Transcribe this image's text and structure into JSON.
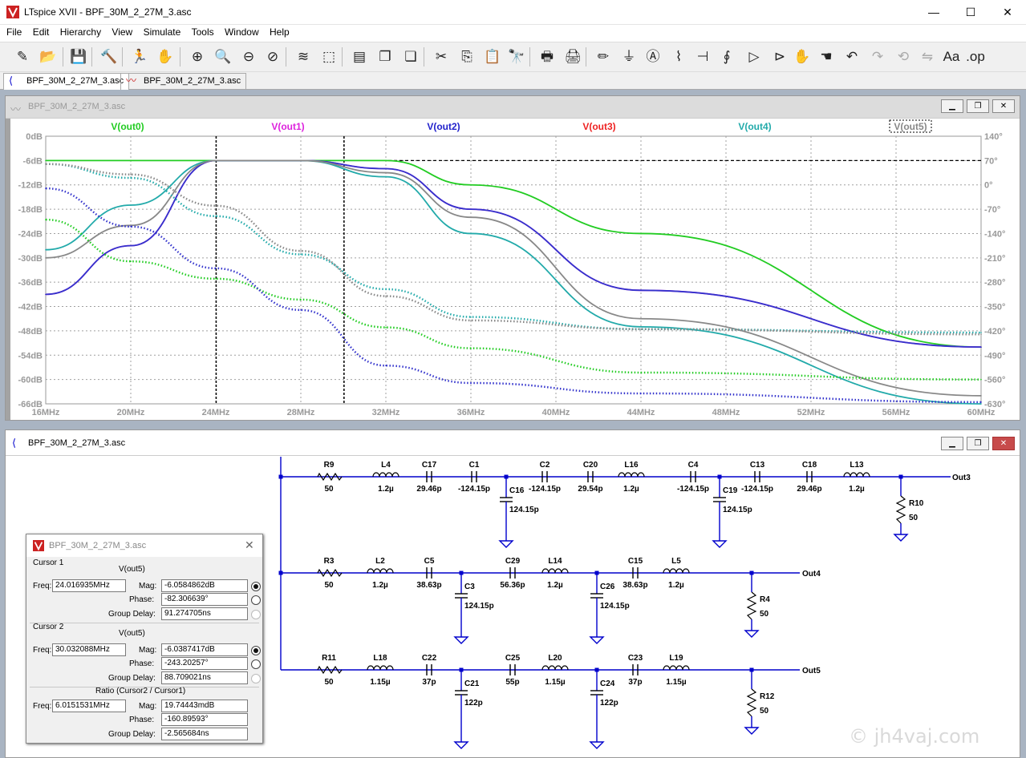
{
  "app": {
    "title": "LTspice XVII - BPF_30M_2_27M_3.asc",
    "menu": [
      "File",
      "Edit",
      "Hierarchy",
      "View",
      "Simulate",
      "Tools",
      "Window",
      "Help"
    ],
    "tabs": [
      {
        "label": "BPF_30M_2_27M_3.asc",
        "icon": "schematic-icon",
        "active": true
      },
      {
        "label": "BPF_30M_2_27M_3.asc",
        "icon": "waveform-icon",
        "active": false
      }
    ],
    "window_controls": {
      "minimize": "—",
      "maximize": "☐",
      "close": "✕"
    }
  },
  "toolbar": [
    {
      "icon": "new-schematic-icon",
      "glyph": "✎"
    },
    {
      "icon": "open-folder-icon",
      "glyph": "📂"
    },
    {
      "icon": "save-icon",
      "glyph": "💾"
    },
    {
      "icon": "control-panel-icon",
      "glyph": "🔨"
    },
    {
      "icon": "run-icon",
      "glyph": "🏃"
    },
    {
      "icon": "halt-icon",
      "glyph": "✋"
    },
    {
      "icon": "zoom-in-icon",
      "glyph": "⊕"
    },
    {
      "icon": "zoom-pan-icon",
      "glyph": "🔍"
    },
    {
      "icon": "zoom-out-icon",
      "glyph": "⊖"
    },
    {
      "icon": "zoom-cancel-icon",
      "glyph": "⊘"
    },
    {
      "icon": "autorange-icon",
      "glyph": "≋"
    },
    {
      "icon": "fit-icon",
      "glyph": "⬚"
    },
    {
      "icon": "tile-horizontal-icon",
      "glyph": "▤"
    },
    {
      "icon": "cascade-icon",
      "glyph": "❐"
    },
    {
      "icon": "tile-vertical-icon",
      "glyph": "❏"
    },
    {
      "icon": "cut-icon",
      "glyph": "✂"
    },
    {
      "icon": "copy-icon",
      "glyph": "⎘"
    },
    {
      "icon": "paste-icon",
      "glyph": "📋"
    },
    {
      "icon": "find-icon",
      "glyph": "🔭"
    },
    {
      "icon": "print-icon",
      "glyph": "🖶"
    },
    {
      "icon": "print-setup-icon",
      "glyph": "🖨"
    },
    {
      "icon": "draw-wire-icon",
      "glyph": "✏"
    },
    {
      "icon": "ground-icon",
      "glyph": "⏚"
    },
    {
      "icon": "label-net-icon",
      "glyph": "Ⓐ"
    },
    {
      "icon": "resistor-icon",
      "glyph": "⌇"
    },
    {
      "icon": "capacitor-icon",
      "glyph": "⊣"
    },
    {
      "icon": "inductor-icon",
      "glyph": "∮"
    },
    {
      "icon": "diode-icon",
      "glyph": "▷"
    },
    {
      "icon": "component-icon",
      "glyph": "⊳"
    },
    {
      "icon": "move-icon",
      "glyph": "✋"
    },
    {
      "icon": "drag-icon",
      "glyph": "☚"
    },
    {
      "icon": "undo-icon",
      "glyph": "↶"
    },
    {
      "icon": "redo-icon",
      "glyph": "↷"
    },
    {
      "icon": "rotate-icon",
      "glyph": "⟲"
    },
    {
      "icon": "mirror-icon",
      "glyph": "⇋"
    },
    {
      "icon": "text-icon",
      "glyph": "Aa"
    },
    {
      "icon": "spice-directive-icon",
      "glyph": ".op"
    }
  ],
  "plot_window": {
    "title": "BPF_30M_2_27M_3.asc",
    "y_left_ticks": [
      "0dB",
      "-6dB",
      "-12dB",
      "-18dB",
      "-24dB",
      "-30dB",
      "-36dB",
      "-42dB",
      "-48dB",
      "-54dB",
      "-60dB",
      "-66dB"
    ],
    "y_right_ticks": [
      "140°",
      "70°",
      "0°",
      "-70°",
      "-140°",
      "-210°",
      "-280°",
      "-350°",
      "-420°",
      "-490°",
      "-560°",
      "-630°"
    ],
    "x_ticks": [
      "16MHz",
      "20MHz",
      "24MHz",
      "28MHz",
      "32MHz",
      "36MHz",
      "40MHz",
      "44MHz",
      "48MHz",
      "52MHz",
      "56MHz",
      "60MHz"
    ],
    "trace_labels": [
      {
        "label": "V(out0)",
        "color": "#22cc22"
      },
      {
        "label": "V(out1)",
        "color": "#dd22dd"
      },
      {
        "label": "V(out2)",
        "color": "#2222cc"
      },
      {
        "label": "V(out3)",
        "color": "#ee2222"
      },
      {
        "label": "V(out4)",
        "color": "#22aaaa"
      },
      {
        "label": "V(out5)",
        "color": "#888888"
      }
    ],
    "colors": {
      "axis_text": "#999999",
      "grid": "#a0a0a0",
      "cursor": "#000000"
    }
  },
  "chart_data": {
    "type": "line",
    "xlabel": "",
    "ylabel": "",
    "x_unit": "MHz",
    "xlim": [
      16,
      60
    ],
    "ylim": [
      -66,
      0
    ],
    "y2lim": [
      -630,
      140
    ],
    "x": [
      16,
      20,
      24,
      28,
      32,
      36,
      44,
      60
    ],
    "cursors": [
      24.016935,
      30.032088
    ],
    "series": [
      {
        "name": "V(out0)",
        "kind": "mag",
        "color": "#22cc22",
        "values": [
          -6,
          -6,
          -6,
          -6,
          -6,
          -12,
          -24,
          -52
        ]
      },
      {
        "name": "V(out1)",
        "kind": "mag",
        "color": "#dd22dd",
        "values": [
          -39,
          -27,
          -6,
          -6,
          -8,
          -18,
          -38,
          -52
        ]
      },
      {
        "name": "V(out2)",
        "kind": "mag",
        "color": "#3333cc",
        "values": [
          -39,
          -27,
          -6,
          -6,
          -8,
          -18,
          -38,
          -52
        ]
      },
      {
        "name": "V(out4)",
        "kind": "mag",
        "color": "#22aaaa",
        "values": [
          -28,
          -17,
          -6,
          -6,
          -10,
          -24,
          -47,
          -66
        ]
      },
      {
        "name": "V(out5)",
        "kind": "mag",
        "color": "#888888",
        "values": [
          -30,
          -22,
          -6,
          -6,
          -9,
          -20,
          -45,
          -64
        ]
      },
      {
        "name": "V(out0)",
        "kind": "phase",
        "color": "#22cc22",
        "values": [
          -100,
          -220,
          -270,
          -330,
          -410,
          -470,
          -540,
          -560
        ]
      },
      {
        "name": "V(out2)",
        "kind": "phase",
        "color": "#3333cc",
        "values": [
          -10,
          -120,
          -240,
          -360,
          -520,
          -570,
          -600,
          -625
        ]
      },
      {
        "name": "V(out4)",
        "kind": "phase",
        "color": "#22aaaa",
        "values": [
          60,
          20,
          -90,
          -200,
          -300,
          -380,
          -415,
          -425
        ]
      },
      {
        "name": "V(out5)",
        "kind": "phase",
        "color": "#888888",
        "values": [
          60,
          30,
          -60,
          -190,
          -320,
          -390,
          -415,
          -430
        ]
      }
    ]
  },
  "schematic_window": {
    "title": "BPF_30M_2_27M_3.asc",
    "components": [
      {
        "ref": "R9",
        "val": "50"
      },
      {
        "ref": "L4",
        "val": "1.2µ"
      },
      {
        "ref": "C17",
        "val": "29.46p"
      },
      {
        "ref": "C1",
        "val": "-124.15p"
      },
      {
        "ref": "C2",
        "val": "-124.15p"
      },
      {
        "ref": "C20",
        "val": "29.54p"
      },
      {
        "ref": "L16",
        "val": "1.2µ"
      },
      {
        "ref": "C4",
        "val": "-124.15p"
      },
      {
        "ref": "C13",
        "val": "-124.15p"
      },
      {
        "ref": "C18",
        "val": "29.46p"
      },
      {
        "ref": "L13",
        "val": "1.2µ"
      },
      {
        "ref": "C16",
        "val": "124.15p"
      },
      {
        "ref": "C19",
        "val": "124.15p"
      },
      {
        "ref": "R10",
        "val": "50"
      },
      {
        "ref": "R3",
        "val": "50"
      },
      {
        "ref": "L2",
        "val": "1.2µ"
      },
      {
        "ref": "C5",
        "val": "38.63p"
      },
      {
        "ref": "C29",
        "val": "56.36p"
      },
      {
        "ref": "L14",
        "val": "1.2µ"
      },
      {
        "ref": "C15",
        "val": "38.63p"
      },
      {
        "ref": "L5",
        "val": "1.2µ"
      },
      {
        "ref": "C3",
        "val": "124.15p"
      },
      {
        "ref": "C26",
        "val": "124.15p"
      },
      {
        "ref": "R4",
        "val": "50"
      },
      {
        "ref": "R11",
        "val": "50"
      },
      {
        "ref": "L18",
        "val": "1.15µ"
      },
      {
        "ref": "C22",
        "val": "37p"
      },
      {
        "ref": "C25",
        "val": "55p"
      },
      {
        "ref": "L20",
        "val": "1.15µ"
      },
      {
        "ref": "C23",
        "val": "37p"
      },
      {
        "ref": "L19",
        "val": "1.15µ"
      },
      {
        "ref": "C21",
        "val": "122p"
      },
      {
        "ref": "C24",
        "val": "122p"
      },
      {
        "ref": "R12",
        "val": "50"
      }
    ],
    "net_labels": [
      "Out3",
      "Out4",
      "Out5"
    ],
    "colors": {
      "wire": "#0000cc",
      "text": "#000000"
    }
  },
  "cursor_window": {
    "title": "BPF_30M_2_27M_3.asc",
    "cursor1": {
      "header": "Cursor 1",
      "trace": "V(out5)",
      "freq_label": "Freq:",
      "freq": "24.016935MHz",
      "mag_label": "Mag:",
      "mag": "-6.0584862dB",
      "phase_label": "Phase:",
      "phase": "-82.306639°",
      "gd_label": "Group Delay:",
      "gd": "91.274705ns"
    },
    "cursor2": {
      "header": "Cursor 2",
      "trace": "V(out5)",
      "freq_label": "Freq:",
      "freq": "30.032088MHz",
      "mag_label": "Mag:",
      "mag": "-6.0387417dB",
      "phase_label": "Phase:",
      "phase": "-243.20257°",
      "gd_label": "Group Delay:",
      "gd": "88.709021ns"
    },
    "ratio": {
      "header": "Ratio (Cursor2 / Cursor1)",
      "freq_label": "Freq:",
      "freq": "6.0151531MHz",
      "mag_label": "Mag:",
      "mag": "19.74443mdB",
      "phase_label": "Phase:",
      "phase": "-160.89593°",
      "gd_label": "Group Delay:",
      "gd": "-2.565684ns"
    },
    "close": "✕"
  },
  "watermark": "© jh4vaj.com"
}
